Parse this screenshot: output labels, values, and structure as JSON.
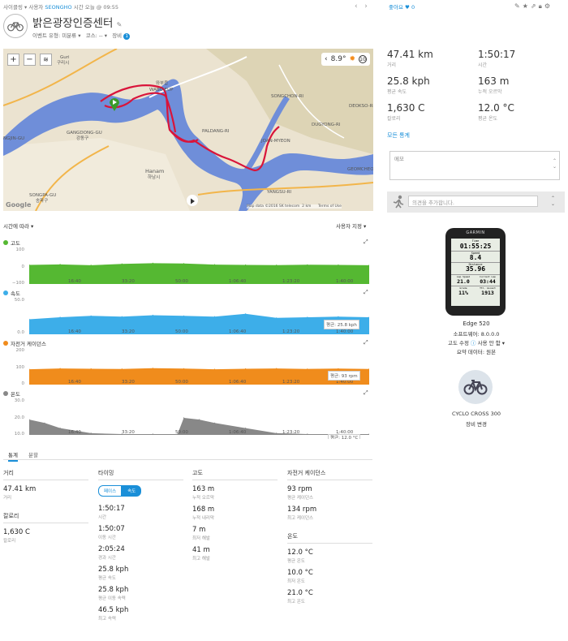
{
  "header": {
    "activity_type": "사이클링",
    "user_prefix": "사용자",
    "user_name": "SEONGHO",
    "time_label": "시간 오늘 @ 09:55",
    "like_label": "좋아요",
    "like_count": "0",
    "title": "밝은광장인증센터",
    "event_type": "이벤트 유형: 미분류",
    "course": "코스: --",
    "gear_label": "장비",
    "gear_count": "1"
  },
  "map": {
    "zoom_in": "+",
    "zoom_out": "−",
    "temperature": "8.9°",
    "wind": "10",
    "attribution": "Map data ©2016 SK telecom",
    "scale": "2 km",
    "terms": "Terms of Use",
    "google": "Google",
    "places": [
      "Guri 구리시",
      "WABU-EUP 와부읍",
      "GANGDONG-GU 강동구",
      "Hanam 하남시",
      "SONGPA-GU 송파구",
      "NGJIN-GU",
      "JOAN-MYEON 조안면",
      "SONGCHON-RI",
      "DUGYONG-RI",
      "YANGSU-RI 양수리",
      "GEOMCHEON-RI",
      "DEOKSO-RI",
      "PALDANG-RI"
    ],
    "route_color": "#d9143a",
    "water_color": "#6f8ed9"
  },
  "chart_controls": {
    "x_axis_mode": "시간에 따라",
    "custom": "사용자 지정"
  },
  "chart_data": [
    {
      "type": "area",
      "title": "고도",
      "color": "#55b832",
      "ylim": [
        -100,
        100
      ],
      "y_ticks": [
        "100",
        "0",
        "−100"
      ],
      "x_ticks": [
        "16:40",
        "33:20",
        "50:00",
        "1:06:40",
        "1:23:20",
        "1:40:00"
      ],
      "x": [
        0,
        10,
        20,
        30,
        40,
        50,
        60,
        70,
        80,
        90,
        100,
        110
      ],
      "values": [
        12,
        15,
        10,
        18,
        22,
        20,
        14,
        12,
        11,
        13,
        12,
        10
      ]
    },
    {
      "type": "area",
      "title": "속도",
      "color": "#3daee9",
      "ylim": [
        0,
        50
      ],
      "y_ticks": [
        "50.0",
        "0.0"
      ],
      "x_ticks": [
        "16:40",
        "33:20",
        "50:00",
        "1:06:40",
        "1:23:20",
        "1:40:00"
      ],
      "average": "평균: 25.8 kph",
      "x": [
        0,
        10,
        20,
        30,
        40,
        50,
        60,
        70,
        80,
        90,
        100,
        110
      ],
      "values": [
        22,
        25,
        27,
        26,
        28,
        27,
        26,
        30,
        24,
        25,
        26,
        25
      ]
    },
    {
      "type": "area",
      "title": "자전거 케이던스",
      "color": "#f08c1c",
      "ylim": [
        0,
        200
      ],
      "y_ticks": [
        "200",
        "100",
        "0"
      ],
      "x_ticks": [
        "16:40",
        "33:20",
        "50:00",
        "1:06:40",
        "1:23:20",
        "1:40:00"
      ],
      "average": "평균: 93 rpm",
      "x": [
        0,
        10,
        20,
        30,
        40,
        50,
        60,
        70,
        80,
        90,
        100,
        110
      ],
      "values": [
        90,
        95,
        93,
        92,
        96,
        94,
        90,
        93,
        95,
        92,
        94,
        92
      ]
    },
    {
      "type": "area",
      "title": "온도",
      "color": "#888888",
      "ylim": [
        10,
        30
      ],
      "y_ticks": [
        "30.0",
        "20.0",
        "10.0"
      ],
      "x_ticks": [
        "16:40",
        "33:20",
        "50:00",
        "1:06:40",
        "1:23:20",
        "1:40:00"
      ],
      "average": "평균: 12.0 °C",
      "x": [
        0,
        5,
        10,
        20,
        30,
        40,
        48,
        50,
        55,
        60,
        70,
        80,
        90,
        100,
        110
      ],
      "values": [
        19,
        17,
        14,
        11,
        10.5,
        10.5,
        10.5,
        20,
        19,
        17,
        14,
        11,
        10.5,
        10.5,
        10.5
      ]
    }
  ],
  "tabs": [
    "통계",
    "분할"
  ],
  "stats": {
    "distance": {
      "header": "거리",
      "value": "47.41 km",
      "label": "거리"
    },
    "calories": {
      "header": "칼로리",
      "value": "1,630 C",
      "label": "칼로리"
    },
    "timing": {
      "header": "타이밍",
      "toggle_pace": "페이스",
      "toggle_speed": "속도",
      "items": [
        {
          "value": "1:50:17",
          "label": "시간"
        },
        {
          "value": "1:50:07",
          "label": "이동 시간"
        },
        {
          "value": "2:05:24",
          "label": "경과 시간"
        },
        {
          "value": "25.8 kph",
          "label": "평균 속도"
        },
        {
          "value": "25.8 kph",
          "label": "평균 이동 속력"
        },
        {
          "value": "46.5 kph",
          "label": "최고 속력"
        }
      ]
    },
    "elevation": {
      "header": "고도",
      "items": [
        {
          "value": "163 m",
          "label": "누적 오르막"
        },
        {
          "value": "168 m",
          "label": "누적 내리막"
        },
        {
          "value": "7 m",
          "label": "최저 해발"
        },
        {
          "value": "41 m",
          "label": "최고 해발"
        }
      ]
    },
    "cadence": {
      "header": "자전거 케이던스",
      "items": [
        {
          "value": "93 rpm",
          "label": "평균 케이던스"
        },
        {
          "value": "134 rpm",
          "label": "최고 케이던스"
        }
      ]
    },
    "temperature": {
      "header": "온도",
      "items": [
        {
          "value": "12.0 °C",
          "label": "평균 온도"
        },
        {
          "value": "10.0 °C",
          "label": "최저 온도"
        },
        {
          "value": "21.0 °C",
          "label": "최고 온도"
        }
      ]
    }
  },
  "summary": {
    "items": [
      {
        "value": "47.41 km",
        "label": "거리"
      },
      {
        "value": "1:50:17",
        "label": "시간"
      },
      {
        "value": "25.8 kph",
        "label": "평균 속도"
      },
      {
        "value": "163 m",
        "label": "누적 오르막"
      },
      {
        "value": "1,630 C",
        "label": "칼로리"
      },
      {
        "value": "12.0 °C",
        "label": "평균 온도"
      }
    ],
    "all_stats_link": "모든 통계",
    "memo_placeholder": "메모",
    "comment_placeholder": "의견을 추가합니다."
  },
  "device": {
    "brand": "GARMIN",
    "screen": {
      "time_label": "Time",
      "time": "01:55:25",
      "speed_label": "Speed",
      "speed": "8.4",
      "distance_label": "Distance",
      "distance": "35.96",
      "lap_speed_label": "Lap Speed",
      "lap_speed": "21.0",
      "current_lap_label": "Current Lap",
      "current_lap": "03:44",
      "grade_label": "Grade",
      "grade": "11%",
      "ascent_label": "Ttl. Ascent",
      "ascent": "1913"
    },
    "name": "Edge 520",
    "software": "소프트웨어: 8.0.0.0",
    "elevation_correction_label": "고도 수정",
    "elevation_correction_value": "사용 안 함",
    "summary_data": "요약 데이터: 원본"
  },
  "gear": {
    "name": "CYCLO CROSS 300",
    "change_link": "장비 변경"
  }
}
